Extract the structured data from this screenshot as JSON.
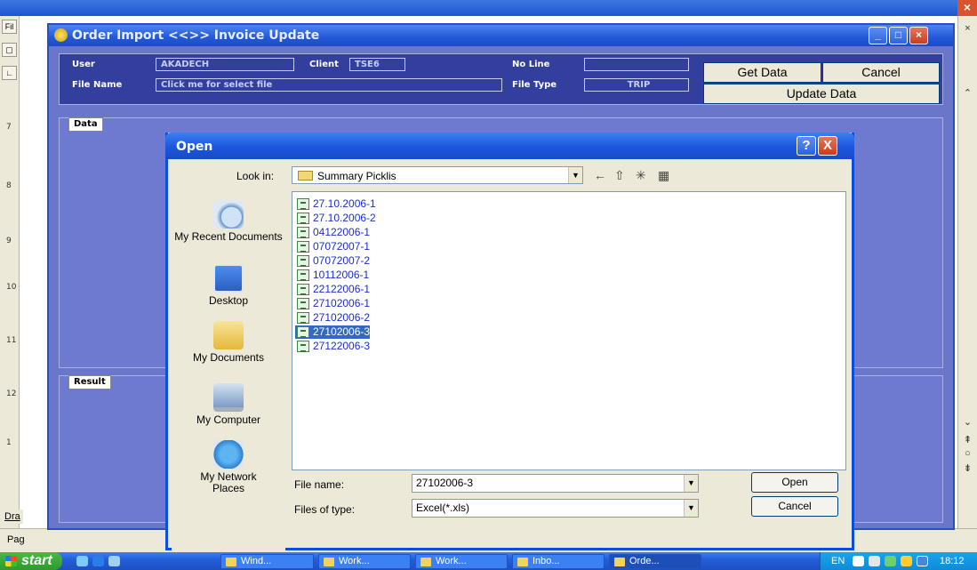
{
  "order_window": {
    "title": "Order Import <<>> Invoice Update",
    "user_label": "User",
    "user_value": "AKADECH",
    "client_label": "Client",
    "client_value": "TSE6",
    "noline_label": "No Line",
    "noline_value": "",
    "filename_label": "File Name",
    "filename_value": "Click me for select file",
    "filetype_label": "File Type",
    "filetype_value": "TRIP",
    "get_data": "Get Data",
    "cancel": "Cancel",
    "update_data": "Update Data",
    "data_tab": "Data",
    "result_tab": "Result"
  },
  "background_app": {
    "page_label": "Pag",
    "draw_label": "Dra",
    "file_menu": "Fil",
    "ruler": [
      "7",
      "8",
      "9",
      "10",
      "11",
      "12",
      "1"
    ]
  },
  "open_dialog": {
    "title": "Open",
    "look_in_label": "Look in:",
    "look_in_value": "Summary Picklis",
    "places": [
      "My Recent Documents",
      "Desktop",
      "My Documents",
      "My Computer",
      "My Network Places"
    ],
    "files": [
      "27.10.2006-1",
      "27.10.2006-2",
      "04122006-1",
      "07072007-1",
      "07072007-2",
      "10112006-1",
      "22122006-1",
      "27102006-1",
      "27102006-2",
      "27102006-3",
      "27122006-3"
    ],
    "selected_file": "27102006-3",
    "file_name_label": "File name:",
    "file_name_value": "27102006-3",
    "file_type_label": "Files of type:",
    "file_type_value": "Excel(*.xls)",
    "open_button": "Open",
    "cancel_button": "Cancel",
    "help_button": "?",
    "close_button": "X"
  },
  "taskbar": {
    "start": "start",
    "items": [
      "Wind...",
      "Work...",
      "Work...",
      "Inbo...",
      "Orde..."
    ],
    "tray_lang": "EN",
    "clock": "18:12"
  }
}
